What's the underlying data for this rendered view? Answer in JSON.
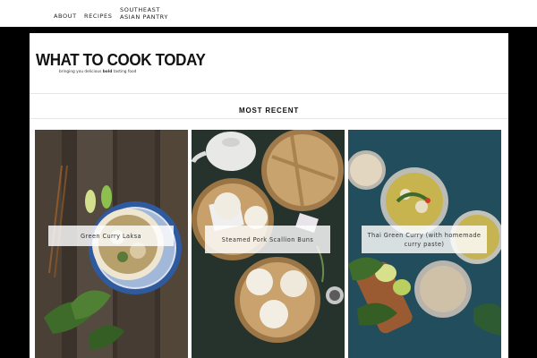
{
  "nav": {
    "items": [
      {
        "label": "ABOUT"
      },
      {
        "label": "RECIPES"
      },
      {
        "label": "SOUTHEAST ASIAN PANTRY"
      }
    ]
  },
  "header": {
    "logo_title": "WHAT TO COOK TODAY",
    "tagline_pre": "bringing you delicious ",
    "tagline_bold": "bold",
    "tagline_post": " tasting food"
  },
  "section": {
    "title": "MOST RECENT"
  },
  "posts": [
    {
      "title": "Green Curry Laksa"
    },
    {
      "title": "Steamed Pork Scallion Buns"
    },
    {
      "title": "Thai Green Curry (with homemade curry paste)"
    }
  ]
}
